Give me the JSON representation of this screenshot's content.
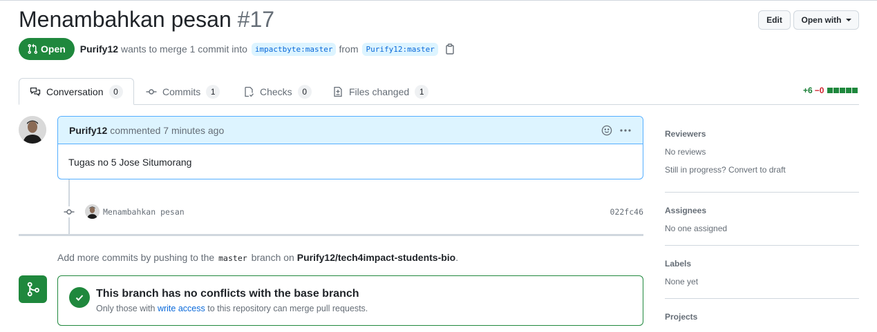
{
  "pr": {
    "title": "Menambahkan pesan",
    "number": "#17",
    "state": "Open",
    "author": "Purify12",
    "merge_text": "wants to merge 1 commit into",
    "base_branch": "impactbyte:master",
    "from_text": "from",
    "head_branch": "Purify12:master"
  },
  "header": {
    "edit_label": "Edit",
    "open_with_label": "Open with"
  },
  "tabs": [
    {
      "label": "Conversation",
      "count": "0",
      "icon": "comment-discussion-icon"
    },
    {
      "label": "Commits",
      "count": "1",
      "icon": "git-commit-icon"
    },
    {
      "label": "Checks",
      "count": "0",
      "icon": "checklist-icon"
    },
    {
      "label": "Files changed",
      "count": "1",
      "icon": "file-diff-icon"
    }
  ],
  "diffstat": {
    "additions": "+6",
    "deletions": "−0",
    "blocks": 5
  },
  "comment": {
    "author": "Purify12",
    "meta": "commented 7 minutes ago",
    "body": "Tugas no 5 Jose Situmorang"
  },
  "commit": {
    "message": "Menambahkan pesan",
    "sha": "022fc46"
  },
  "push_note": {
    "prefix": "Add more commits by pushing to the",
    "branch": "master",
    "middle": "branch on",
    "repo": "Purify12/tech4impact-students-bio",
    "suffix": "."
  },
  "merge": {
    "title": "This branch has no conflicts with the base branch",
    "sub_prefix": "Only those with",
    "sub_link": "write access",
    "sub_suffix": "to this repository can merge pull requests."
  },
  "sidebar": {
    "reviewers": {
      "heading": "Reviewers",
      "value": "No reviews",
      "extra": "Still in progress? Convert to draft"
    },
    "assignees": {
      "heading": "Assignees",
      "value": "No one assigned"
    },
    "labels": {
      "heading": "Labels",
      "value": "None yet"
    },
    "projects": {
      "heading": "Projects"
    }
  },
  "colors": {
    "open_green": "#1f883d",
    "link_blue": "#0969da",
    "comment_header": "#ddf4ff",
    "deletion_red": "#cf222e"
  }
}
